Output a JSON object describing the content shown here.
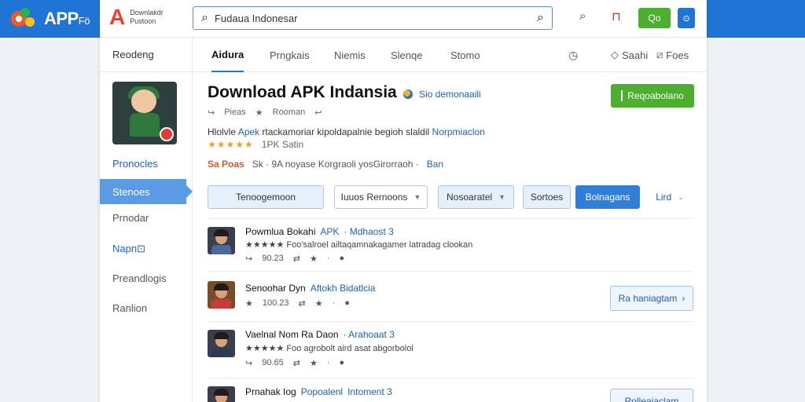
{
  "outer": {
    "logo_text": "APP",
    "logo_sub": "Fö"
  },
  "brand": {
    "line1": "Downlakdr",
    "line2": "Pustoon"
  },
  "search": {
    "query": "Fudaua Indonesar"
  },
  "topbar": {
    "green_btn": "Qo",
    "blue_btn": "⊙"
  },
  "sidebar": {
    "heading": "Reodeng",
    "items": [
      {
        "label": "Pronocles",
        "style": "blue"
      },
      {
        "label": "Stenoes",
        "style": "active"
      },
      {
        "label": "Prnodar",
        "style": ""
      },
      {
        "label": "Napn⊡",
        "style": "blue"
      },
      {
        "label": "Preandlogis",
        "style": ""
      },
      {
        "label": "Ranlion",
        "style": ""
      }
    ]
  },
  "tabs": [
    "Aidura",
    "Prngkais",
    "Niemis",
    "Slenqe",
    "Stomo"
  ],
  "tab_actions": {
    "a": "Saahi",
    "b": "Foes"
  },
  "app": {
    "title": "Download APK Indansia",
    "dev": "Sio demonaaili",
    "meta_1": "Pieas",
    "meta_2": "Rooman",
    "desc_a": "Hlolvle",
    "desc_b": "Apek",
    "desc_c": "rtackamoriar kipoldapalnie begioh slaldil",
    "desc_d": "Norpmiaclon",
    "stars": "★★★★★",
    "rating_text": "1PK Satin",
    "tag_orange": "Sa Poas",
    "tag_mid": "Sk · 9A noyase Korgraoli yosGirorraoh ·",
    "tag_blue": "Ban",
    "primary_btn": "Reqoabolano"
  },
  "filters": {
    "f1": "Tenoogemoon",
    "f2": "Iuuos Rernoons",
    "f3": "Nosoaratel",
    "f4": "Sortoes",
    "f5": "Bolnagans",
    "f6": "Lird"
  },
  "rows": [
    {
      "title": "Powmlua Bokahi",
      "blue": "APK",
      "blue2": "· Mdhaost 3",
      "sub": "★★★★★  Foo'salroel ailtaqamnakagamer latradag clookan",
      "n1": "90.23",
      "button": ""
    },
    {
      "title": "Senoohar Dyn",
      "blue": "Aftokh Bidatlcia",
      "blue2": "",
      "sub": "",
      "n1": "100.23",
      "button": "Ra haniagtam"
    },
    {
      "title": "Vaelnal Nom Ra Daon",
      "blue": "· Arahoaat 3",
      "blue2": "",
      "sub": "★★★★★  Foo agrobolt aird asat abgorbolol",
      "n1": "90.65",
      "button": ""
    },
    {
      "title": "Prnahak Iog",
      "blue": "Popoalenl",
      "blue2": "Intoment 3",
      "sub": "",
      "n1": "",
      "button": "Rolleaiaclam"
    }
  ]
}
